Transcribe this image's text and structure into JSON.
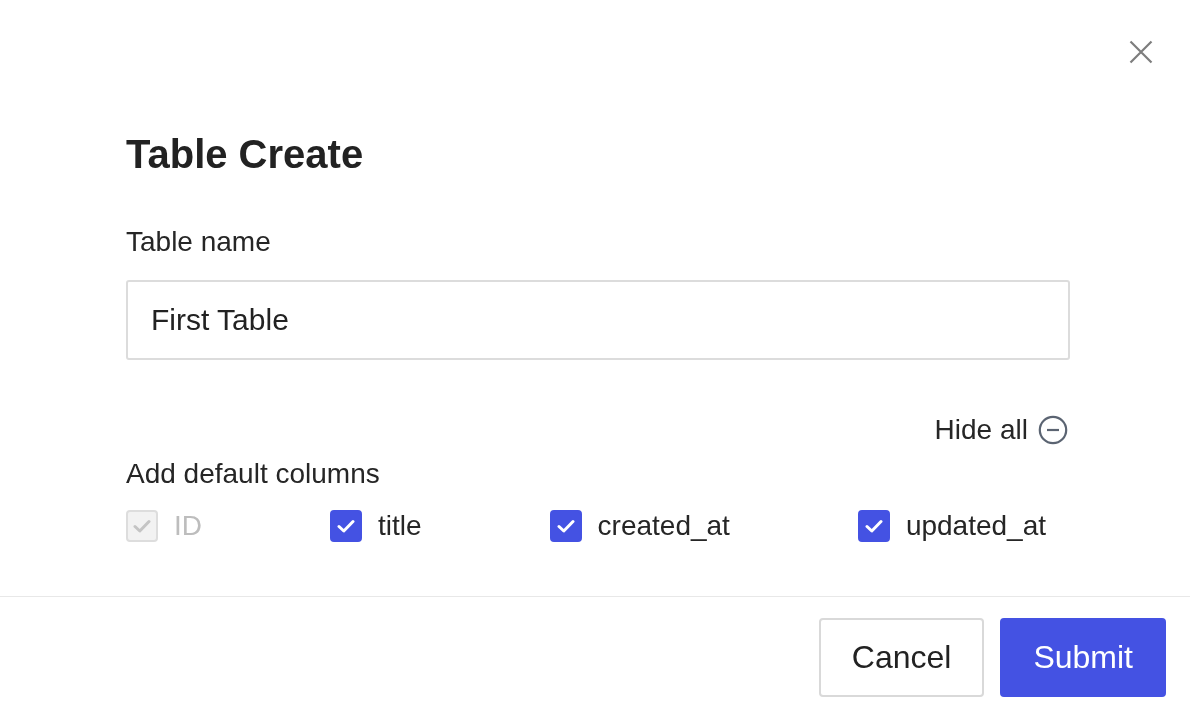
{
  "dialog": {
    "title": "Table Create",
    "table_name_field": {
      "label": "Table name",
      "value": "First Table"
    },
    "hide_all_button": {
      "label": "Hide all"
    },
    "default_columns": {
      "label": "Add default columns",
      "options": [
        {
          "label": "ID",
          "checked": true,
          "disabled": true
        },
        {
          "label": "title",
          "checked": true,
          "disabled": false
        },
        {
          "label": "created_at",
          "checked": true,
          "disabled": false
        },
        {
          "label": "updated_at",
          "checked": true,
          "disabled": false
        }
      ]
    },
    "buttons": [
      {
        "label": "Cancel",
        "kind": "secondary"
      },
      {
        "label": "Submit",
        "kind": "primary"
      }
    ]
  }
}
